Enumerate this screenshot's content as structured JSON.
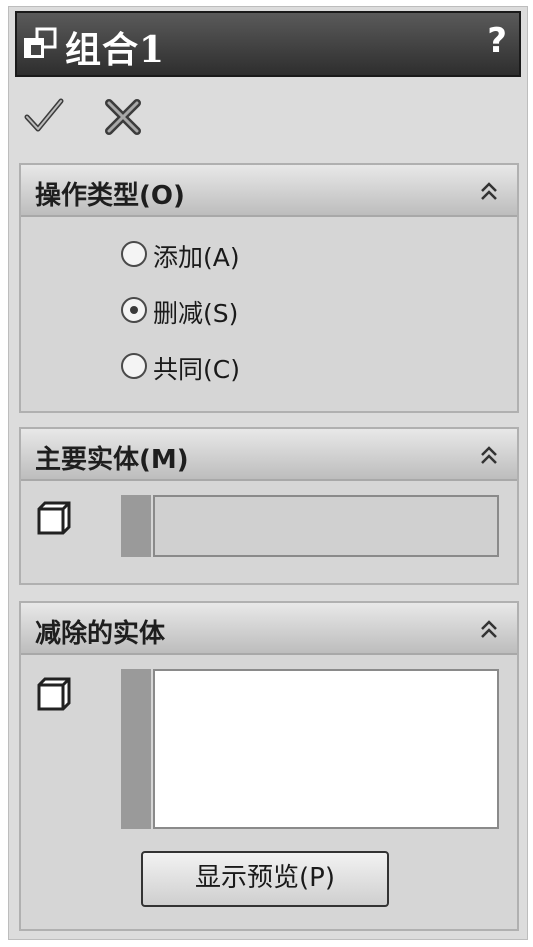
{
  "title_bar": {
    "title": "组合1",
    "help_label": "?"
  },
  "actions": {
    "ok_icon": "checkmark-icon",
    "cancel_icon": "x-icon"
  },
  "operation_type": {
    "header": "操作类型(O)",
    "options": [
      {
        "label": "添加(A)",
        "selected": false
      },
      {
        "label": "删减(S)",
        "selected": true
      },
      {
        "label": "共同(C)",
        "selected": false
      }
    ]
  },
  "main_body": {
    "header": "主要实体(M)",
    "value": ""
  },
  "bodies_to_subtract": {
    "header": "减除的实体",
    "value": "",
    "preview_button": "显示预览(P)"
  },
  "colors": {
    "title_bg": "#3a3a3a",
    "panel_bg": "#dcdcdc",
    "group_header": "#cfcfcf"
  }
}
